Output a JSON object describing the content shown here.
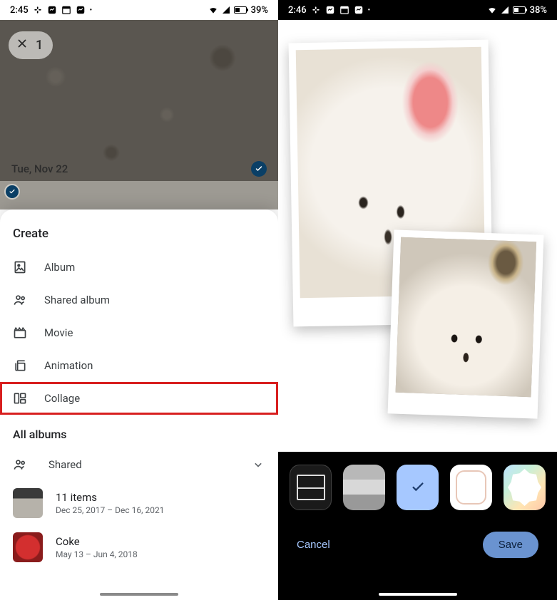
{
  "left": {
    "status": {
      "time": "2:45",
      "battery": "39%"
    },
    "selection_count": "1",
    "date_header": "Tue, Nov 22",
    "sheet": {
      "title": "Create",
      "items": [
        {
          "label": "Album"
        },
        {
          "label": "Shared album"
        },
        {
          "label": "Movie"
        },
        {
          "label": "Animation"
        },
        {
          "label": "Collage"
        }
      ],
      "all_albums_title": "All albums",
      "shared_label": "Shared",
      "albums": [
        {
          "title": "11 items",
          "subtitle": "Dec 25, 2017 – Dec 16, 2021"
        },
        {
          "title": "Coke",
          "subtitle": "May 13 – Jun 4, 2018"
        }
      ]
    }
  },
  "right": {
    "status": {
      "time": "2:46",
      "battery": "38%"
    },
    "actions": {
      "cancel": "Cancel",
      "save": "Save"
    }
  }
}
